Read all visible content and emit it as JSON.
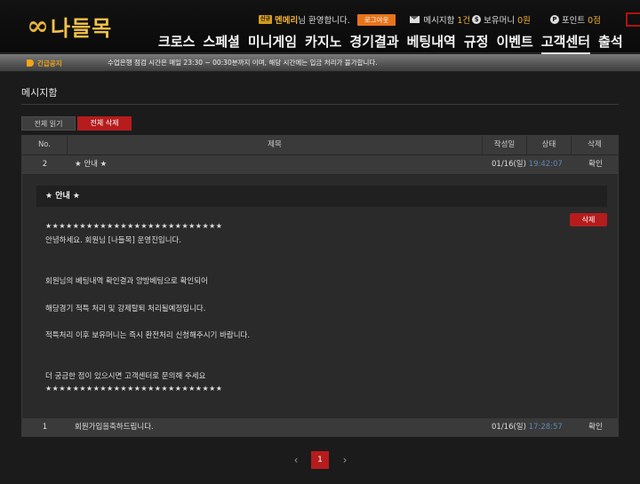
{
  "header": {
    "logo_mark": "∞",
    "logo_text": "나들목",
    "level_badge": "신규",
    "username": "멘메리",
    "greeting": "님 환영합니다.",
    "logout_label": "로그아웃",
    "message_label": "메시지함",
    "message_count": "1건",
    "balance_label": "보유머니",
    "balance_value": "0원",
    "point_label": "포인트",
    "point_value": "0점",
    "nav": [
      "크로스",
      "스페셜",
      "미니게임",
      "카지노",
      "경기결과",
      "베팅내역",
      "규정",
      "이벤트",
      "고객센터",
      "출석"
    ],
    "active_nav": "고객센터"
  },
  "notice": {
    "label": "긴급공지",
    "text": "수업은행 점검 시간은 매일 23:30 ~ 00:30분까지 이며, 해당 시간에는 입금 처리가 불가합니다."
  },
  "page": {
    "title": "메시지함",
    "read_all_label": "전체 읽기",
    "delete_all_label": "전체 삭제"
  },
  "table": {
    "headers": {
      "no": "No.",
      "title": "제목",
      "date": "작성일",
      "status": "상태",
      "delete": "삭제"
    },
    "rows": [
      {
        "no": "2",
        "title": "★ 안내 ★",
        "date": "01/16(일)",
        "time": "19:42:07",
        "status": "확인"
      },
      {
        "no": "1",
        "title": "회원가입을축하드립니다.",
        "date": "01/16(일)",
        "time": "17:28:57",
        "status": "확인"
      }
    ]
  },
  "detail": {
    "title": "★ 안내 ★",
    "delete_label": "삭제",
    "stars": "★★★★★★★★★★★★★★★★★★★★★★★★★★",
    "line1": "안녕하세요. 회원님 [나들목] 운영진입니다.",
    "line2": "회원님의 베팅내역 확인결과 양방베팅으로 확인되어",
    "line3": "해당경기 적특 처리 및 강제탈퇴 처리될예정입니다.",
    "line4": "적특처리 이후 보유머니는 즉시 환전처리 신청해주시기 바랍니다.",
    "line5": "더 궁금한 점이 있으시면 고객센터로 문의해 주세요"
  },
  "pager": {
    "prev": "‹",
    "current": "1",
    "next": "›"
  }
}
